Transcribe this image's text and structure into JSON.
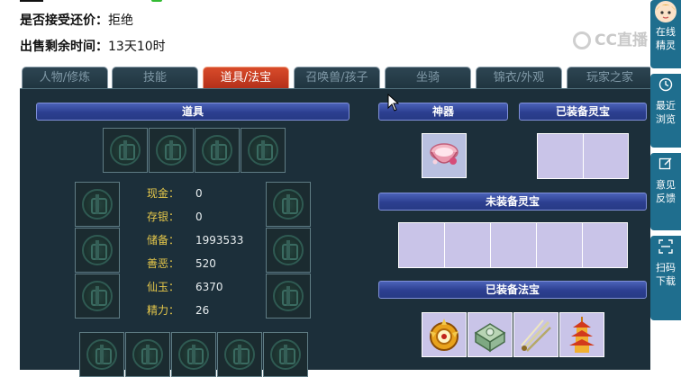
{
  "info": {
    "accept_counter_label": "是否接受还价：",
    "accept_counter_value": "拒绝",
    "remaining_time_label": "出售剩余时间：",
    "remaining_time_value": "13天10时"
  },
  "watermark": "CC直播",
  "tabs": [
    {
      "label": "人物/修炼",
      "active": false
    },
    {
      "label": "技能",
      "active": false
    },
    {
      "label": "道具/法宝",
      "active": true
    },
    {
      "label": "召唤兽/孩子",
      "active": false
    },
    {
      "label": "坐骑",
      "active": false
    },
    {
      "label": "锦衣/外观",
      "active": false
    },
    {
      "label": "玩家之家",
      "active": false
    }
  ],
  "sections": {
    "items_title": "道具",
    "artifact_title": "神器",
    "equipped_lingbao_title": "已装备灵宝",
    "unequipped_lingbao_title": "未装备灵宝",
    "equipped_fabao_title": "已装备法宝"
  },
  "stats": [
    {
      "label": "现金：",
      "value": "0"
    },
    {
      "label": "存银：",
      "value": "0"
    },
    {
      "label": "储备：",
      "value": "1993533"
    },
    {
      "label": "善恶：",
      "value": "520"
    },
    {
      "label": "仙玉：",
      "value": "6370"
    },
    {
      "label": "精力：",
      "value": "26"
    }
  ],
  "sidebar": [
    {
      "label": "在线精灵",
      "icon": "avatar-icon"
    },
    {
      "label": "最近浏览",
      "icon": "clock-icon"
    },
    {
      "label": "意见反馈",
      "icon": "edit-icon"
    },
    {
      "label": "扫码下载",
      "icon": "scan-icon"
    }
  ],
  "colors": {
    "panel_bg": "#1c2f3a",
    "bar_blue": "#2c3f90",
    "tab_active": "#c63a20",
    "stat_label": "#e6c84a",
    "sidebar_blue": "#1f6e8e",
    "lavender_slot": "#c9c4e8"
  }
}
